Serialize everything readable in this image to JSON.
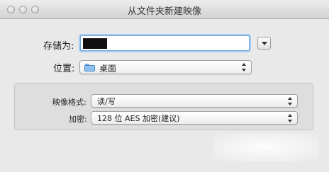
{
  "window": {
    "title": "从文件夹新建映像"
  },
  "save": {
    "label": "存储为:",
    "value": "■■■■"
  },
  "location": {
    "label": "位置:",
    "value": "桌面"
  },
  "options": {
    "format_label": "映像格式:",
    "format_value": "读/写",
    "encryption_label": "加密:",
    "encryption_value": "128 位 AES 加密(建议)"
  },
  "colors": {
    "focus_ring": "#a9cdf0",
    "folder": "#8ec1ee"
  }
}
